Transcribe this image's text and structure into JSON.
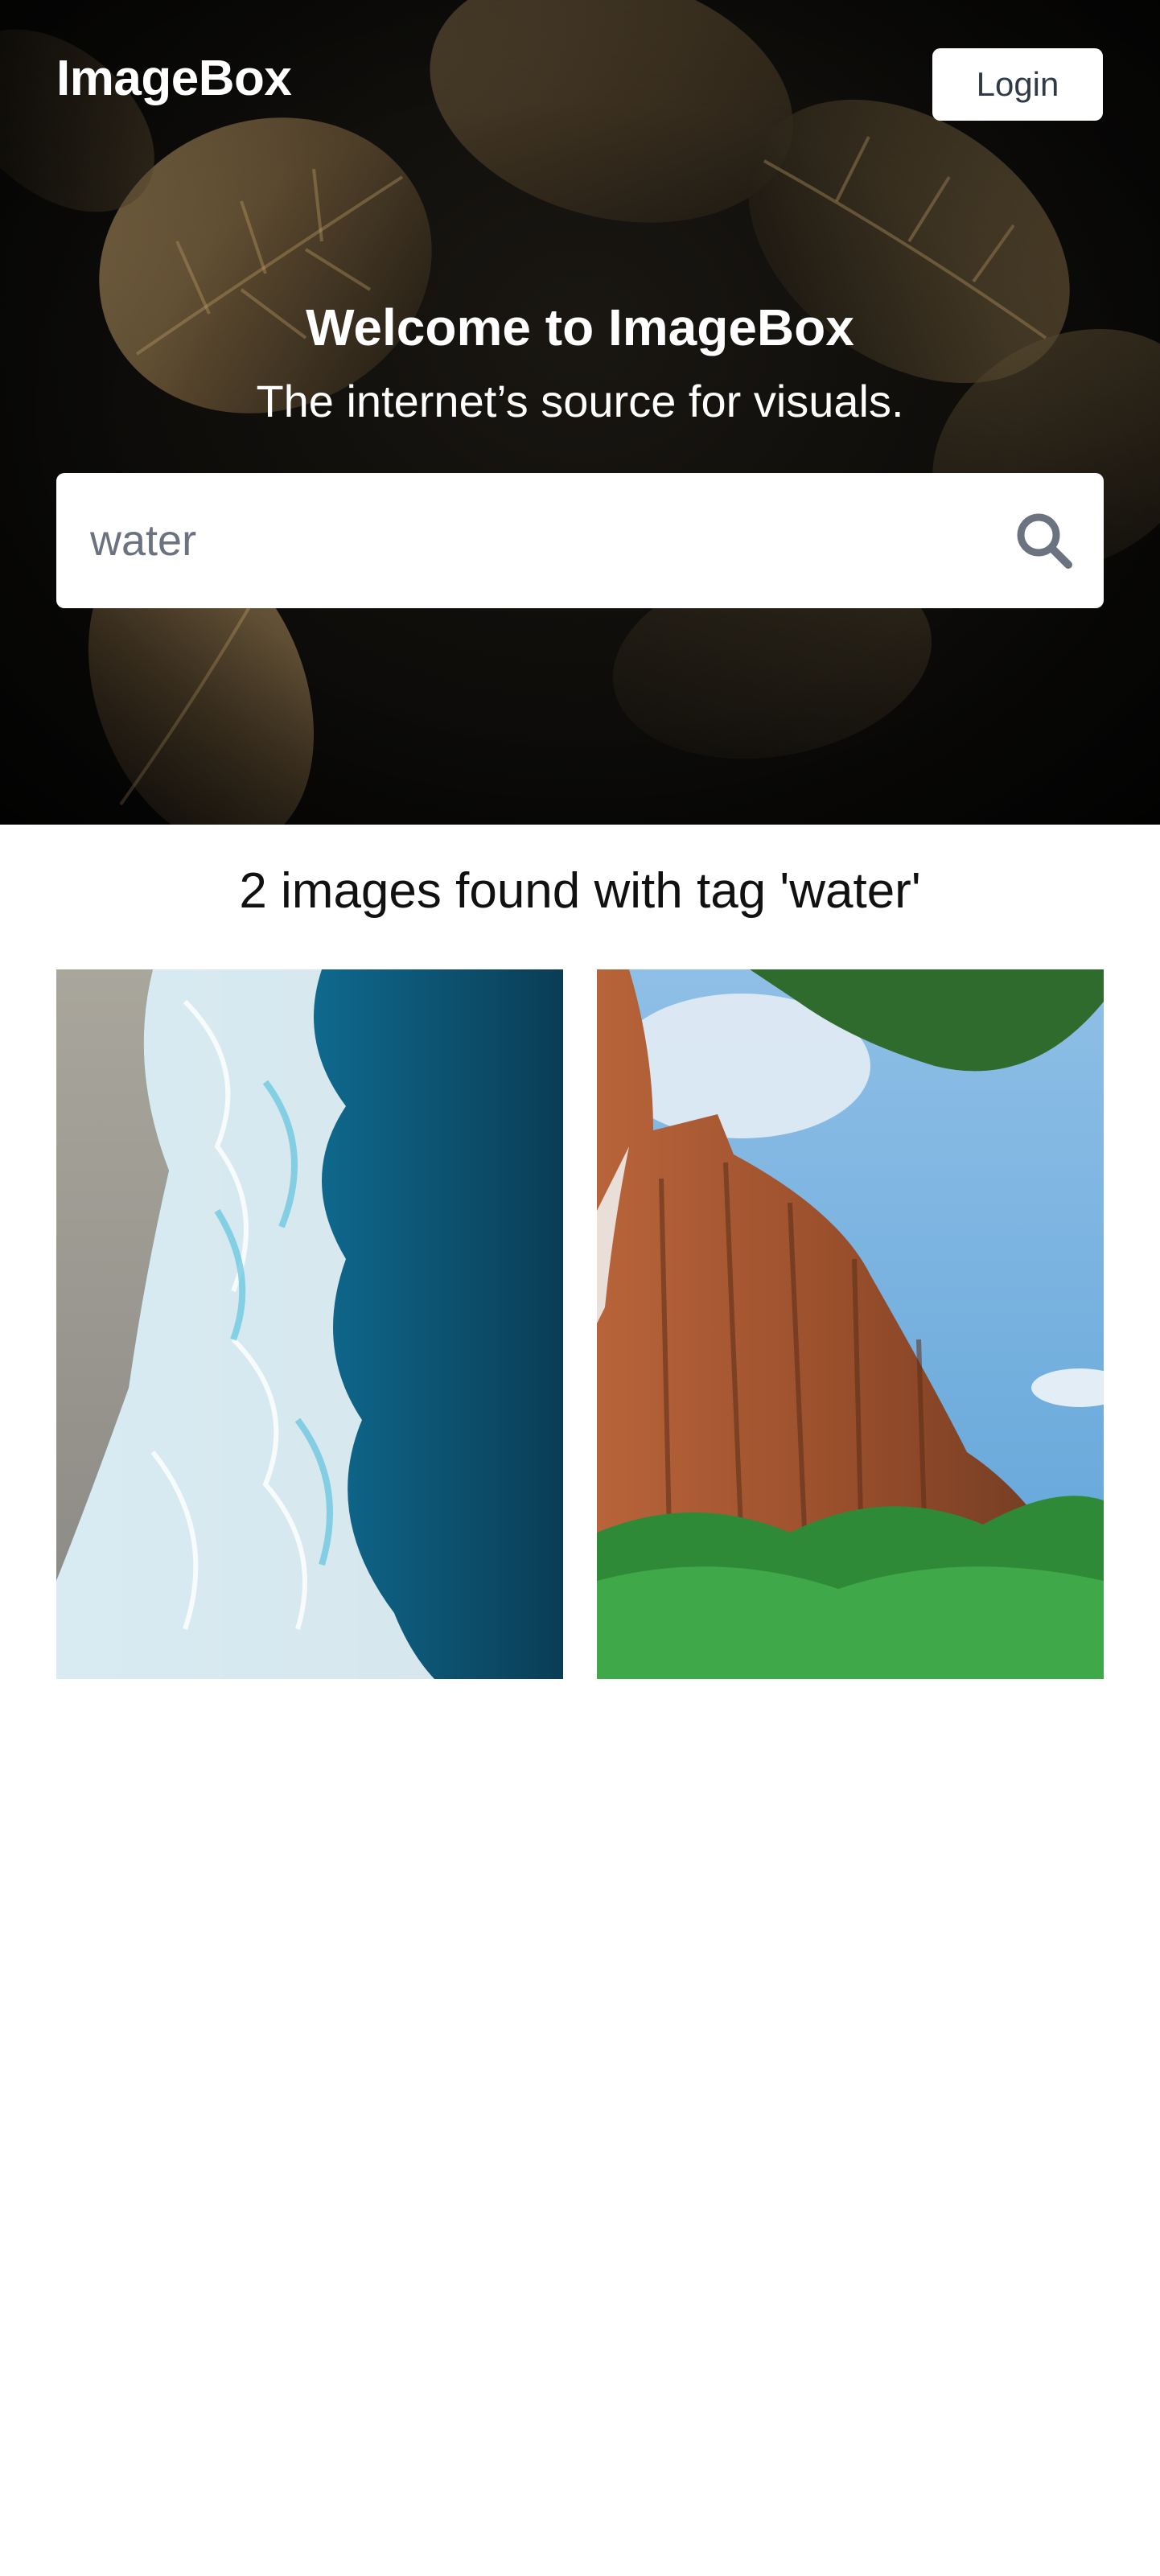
{
  "header": {
    "brand": "ImageBox",
    "login_label": "Login"
  },
  "hero": {
    "title": "Welcome to ImageBox",
    "subtitle": "The internet’s source for visuals."
  },
  "search": {
    "value": "water",
    "icon": "search-icon"
  },
  "results": {
    "heading": "2 images found with tag 'water'",
    "images": [
      {
        "subject": "aerial ocean waves on sand beach"
      },
      {
        "subject": "red rock cliff with waterfall and trees"
      }
    ]
  },
  "colors": {
    "hero_bg": "#0c0b09",
    "leaf_gold": "#7a6340",
    "text_light": "#ffffff",
    "button_text": "#2f3b48",
    "input_text": "#6b7280",
    "icon_gray": "#6b7280"
  }
}
